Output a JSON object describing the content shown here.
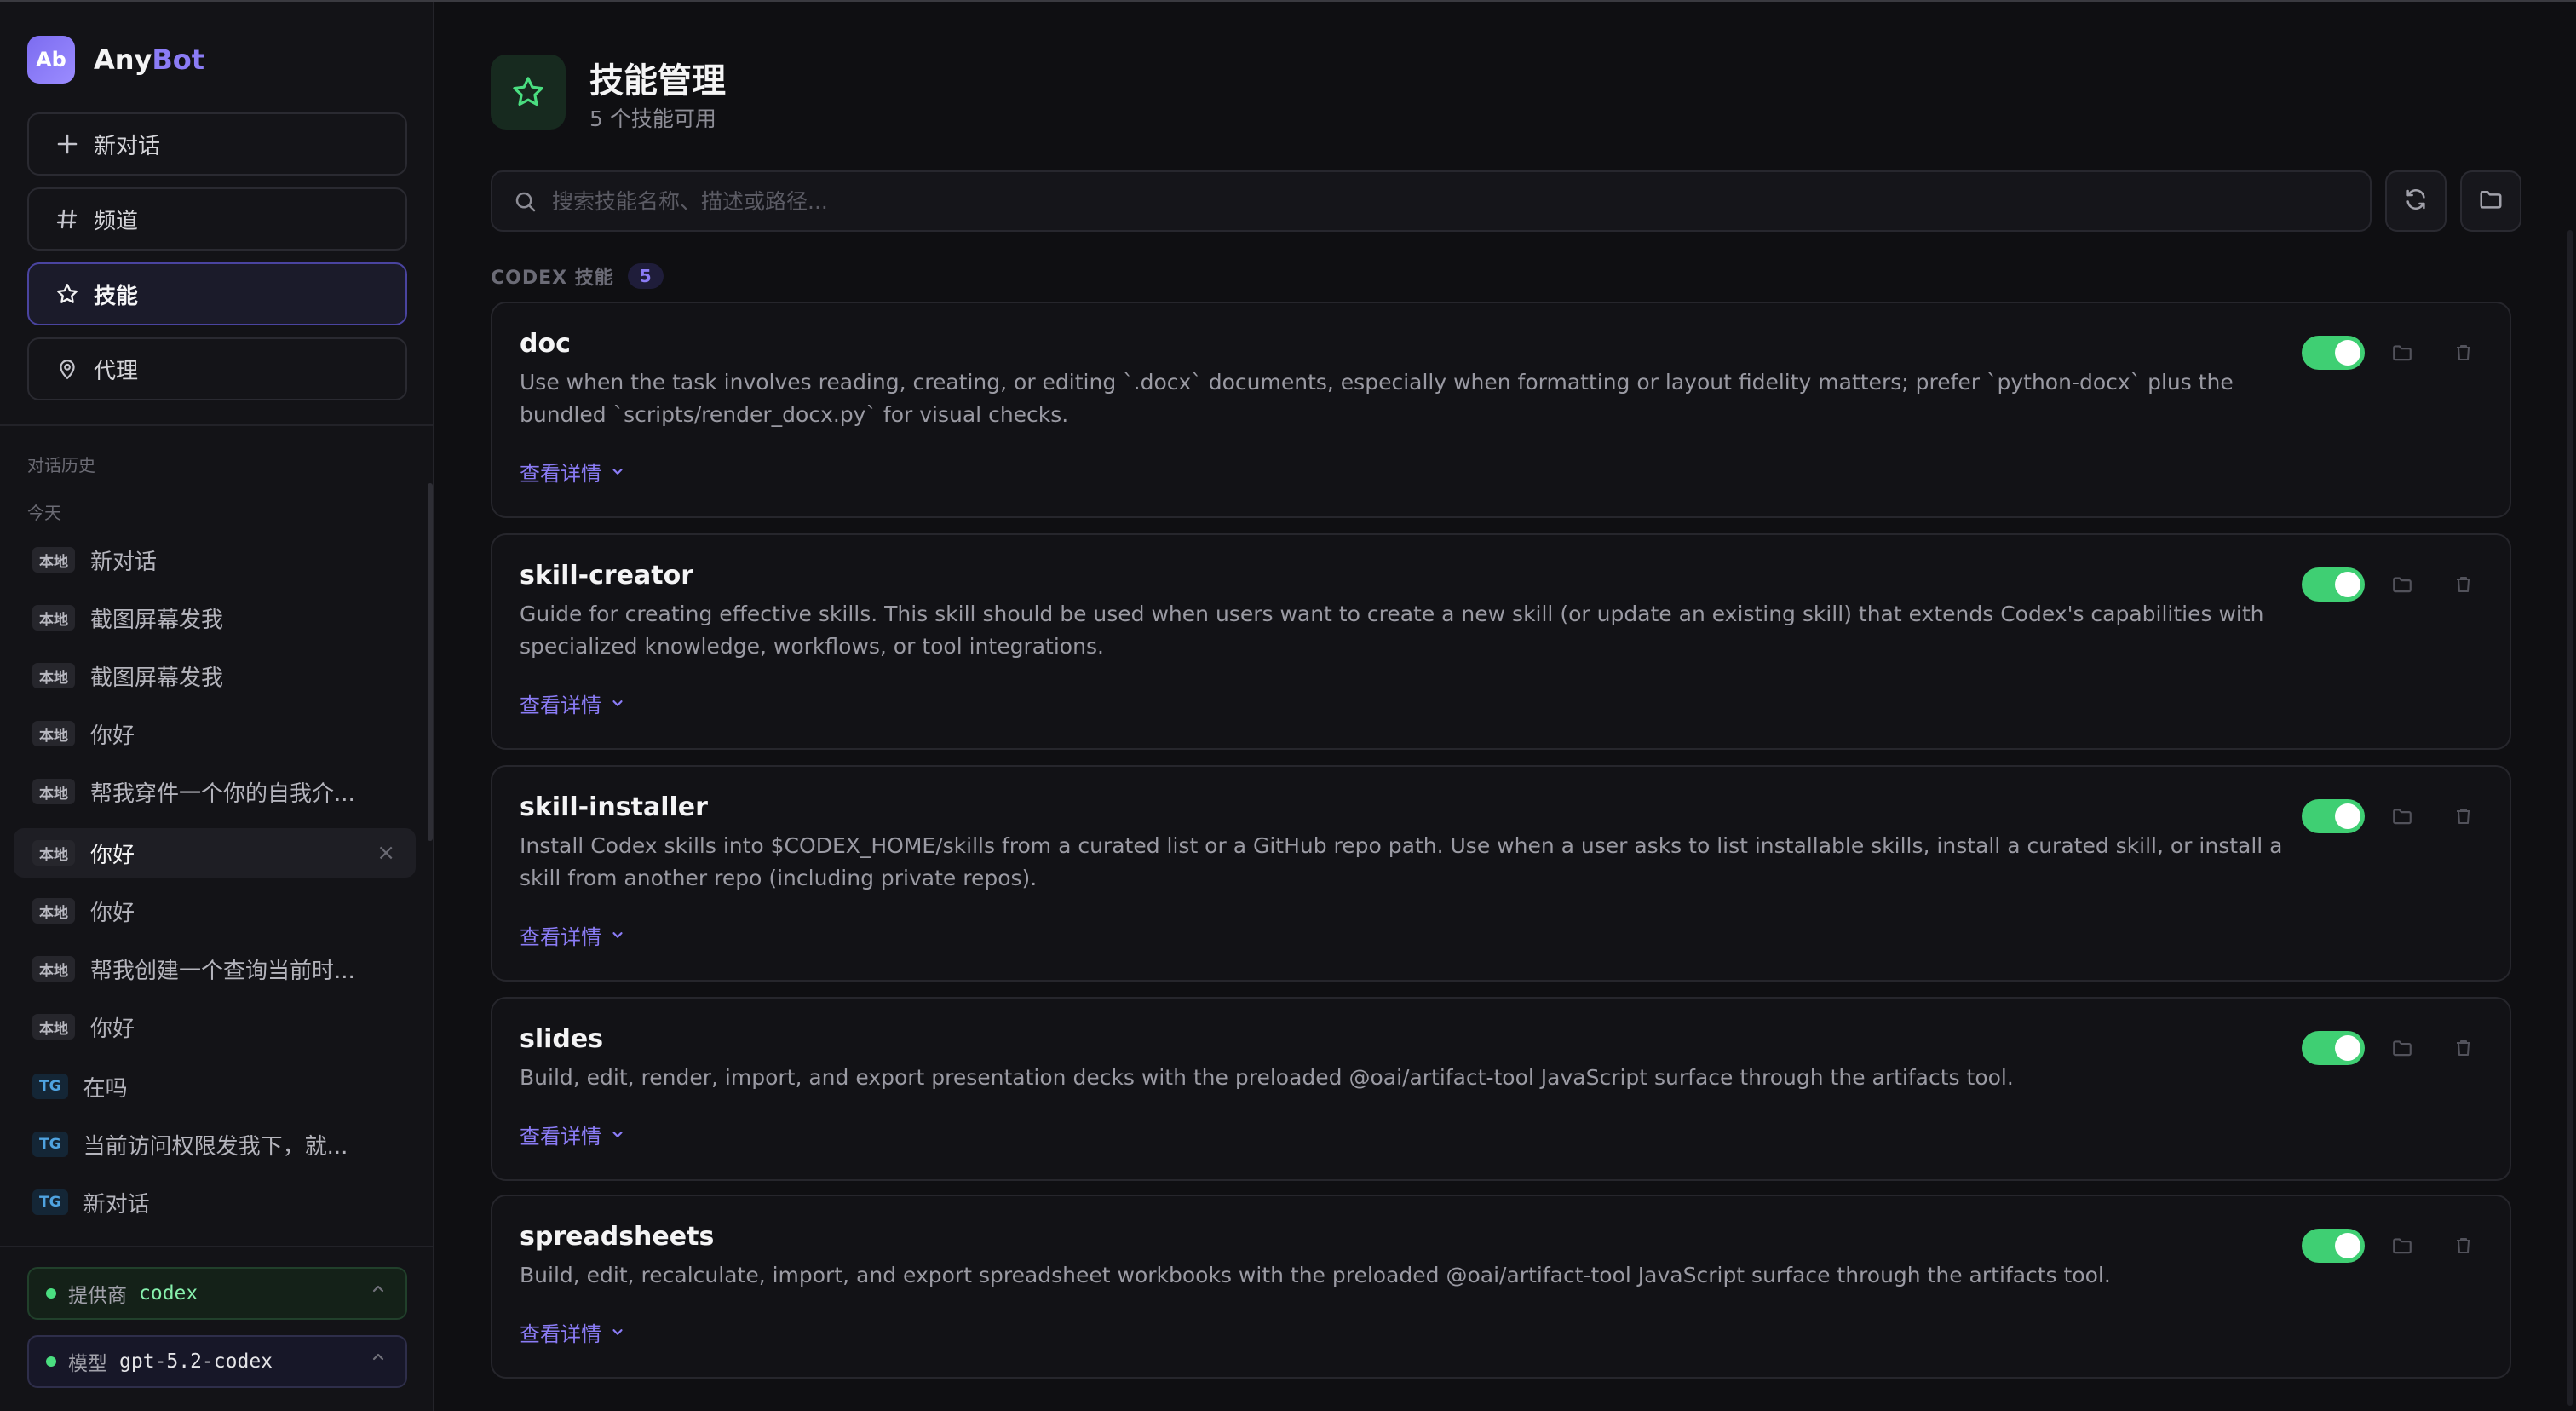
{
  "app": {
    "logo_text": "Ab",
    "name_part1": "Any",
    "name_part2": "Bot",
    "brand_accent": "#8b7cf6"
  },
  "nav": {
    "new_chat": {
      "label": "新对话",
      "icon": "plus-icon"
    },
    "channels": {
      "label": "频道",
      "icon": "hash-icon"
    },
    "skills": {
      "label": "技能",
      "icon": "star-icon",
      "active": true
    },
    "agents": {
      "label": "代理",
      "icon": "location-pin-icon"
    }
  },
  "history": {
    "section_label": "对话历史",
    "group_label": "今天",
    "items": [
      {
        "tag": "本地",
        "title": "新对话"
      },
      {
        "tag": "本地",
        "title": "截图屏幕发我"
      },
      {
        "tag": "本地",
        "title": "截图屏幕发我"
      },
      {
        "tag": "本地",
        "title": "你好"
      },
      {
        "tag": "本地",
        "title": "帮我穿件一个你的自我介..."
      },
      {
        "tag": "本地",
        "title": "你好",
        "active": true,
        "close": "×"
      },
      {
        "tag": "本地",
        "title": "你好"
      },
      {
        "tag": "本地",
        "title": "帮我创建一个查询当前时..."
      },
      {
        "tag": "本地",
        "title": "你好"
      },
      {
        "tag": "TG",
        "title": "在吗"
      },
      {
        "tag": "TG",
        "title": "当前访问权限发我下，就..."
      },
      {
        "tag": "TG",
        "title": "新对话"
      }
    ]
  },
  "footer": {
    "provider": {
      "label": "提供商",
      "value": "codex"
    },
    "model": {
      "label": "模型",
      "value": "gpt-5.2-codex"
    }
  },
  "page": {
    "title": "技能管理",
    "subtitle": "5 个技能可用",
    "icon": "star-icon",
    "accent": "#4ade80"
  },
  "search": {
    "placeholder": "搜索技能名称、描述或路径...",
    "value": ""
  },
  "toolbar": {
    "refresh_icon": "refresh-icon",
    "folder_icon": "folder-icon"
  },
  "section": {
    "title": "CODEX 技能",
    "count": "5"
  },
  "skills": [
    {
      "name": "doc",
      "description": "Use when the task involves reading, creating, or editing `.docx` documents, especially when formatting or layout fidelity matters; prefer `python-docx` plus the bundled `scripts/render_docx.py` for visual checks.",
      "details_label": "查看详情",
      "enabled": true
    },
    {
      "name": "skill-creator",
      "description": "Guide for creating effective skills. This skill should be used when users want to create a new skill (or update an existing skill) that extends Codex's capabilities with specialized knowledge, workflows, or tool integrations.",
      "details_label": "查看详情",
      "enabled": true
    },
    {
      "name": "skill-installer",
      "description": "Install Codex skills into $CODEX_HOME/skills from a curated list or a GitHub repo path. Use when a user asks to list installable skills, install a curated skill, or install a skill from another repo (including private repos).",
      "details_label": "查看详情",
      "enabled": true
    },
    {
      "name": "slides",
      "description": "Build, edit, render, import, and export presentation decks with the preloaded @oai/artifact-tool JavaScript surface through the artifacts tool.",
      "details_label": "查看详情",
      "enabled": true
    },
    {
      "name": "spreadsheets",
      "description": "Build, edit, recalculate, import, and export spreadsheet workbooks with the preloaded @oai/artifact-tool JavaScript surface through the artifacts tool.",
      "details_label": "查看详情",
      "enabled": true
    }
  ],
  "colors": {
    "toggle_on": "#3fcf73",
    "link": "#8b7cf6",
    "tg_tag": "#4fa3e0"
  }
}
